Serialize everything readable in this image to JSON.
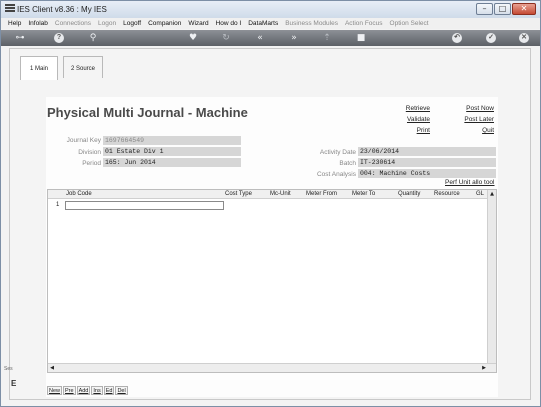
{
  "window": {
    "title": "IES Client v8.36 : My IES"
  },
  "menu": [
    {
      "label": "Help",
      "enabled": true
    },
    {
      "label": "Infolab",
      "enabled": true
    },
    {
      "label": "Connections",
      "enabled": false
    },
    {
      "label": "Logon",
      "enabled": false
    },
    {
      "label": "Logoff",
      "enabled": true
    },
    {
      "label": "Companion",
      "enabled": true
    },
    {
      "label": "Wizard",
      "enabled": true
    },
    {
      "label": "How do I",
      "enabled": true
    },
    {
      "label": "DataMarts",
      "enabled": true
    },
    {
      "label": "Business Modules",
      "enabled": false
    },
    {
      "label": "Action Focus",
      "enabled": false
    },
    {
      "label": "Option Select",
      "enabled": false
    }
  ],
  "toolbar": {
    "icons": [
      "key-icon",
      "help-icon",
      "search-icon",
      "heart-icon",
      "refresh-icon",
      "rewind-icon",
      "fast-forward-icon",
      "upload-icon",
      "stop-icon",
      "back-icon",
      "ok-icon",
      "close-icon"
    ]
  },
  "tabs": [
    {
      "label": "1 Main",
      "active": true
    },
    {
      "label": "2 Source",
      "active": false
    }
  ],
  "page": {
    "title": "Physical Multi Journal - Machine"
  },
  "actions": {
    "retrieve": "Retrieve",
    "validate": "Validate",
    "print": "Print",
    "post_now": "Post Now",
    "post_later": "Post Later",
    "quit": "Quit"
  },
  "fields": {
    "journal_key": {
      "label": "Journal Key",
      "value": "1697664549"
    },
    "division": {
      "label": "Division",
      "value": "01 Estate Div 1"
    },
    "period": {
      "label": "Period",
      "value": "165: Jun 2014"
    },
    "activity_date": {
      "label": "Activity Date",
      "value": "23/06/2014"
    },
    "batch": {
      "label": "Batch",
      "value": "IT-230614"
    },
    "cost_analysis": {
      "label": "Cost Analysis",
      "value": "004: Machine Costs"
    }
  },
  "perf_link": "Perf Unit allo tool",
  "grid": {
    "columns": [
      "Job Code",
      "Cost Type",
      "Mc-Unit",
      "Meter From",
      "Meter To",
      "Quantity",
      "Resource",
      "GL"
    ],
    "rows": [
      "1"
    ]
  },
  "bottom_buttons": [
    "New",
    "Pre",
    "Add",
    "Ins",
    "Ed",
    "Del"
  ],
  "side": {
    "small": "Ses",
    "big": "E"
  }
}
